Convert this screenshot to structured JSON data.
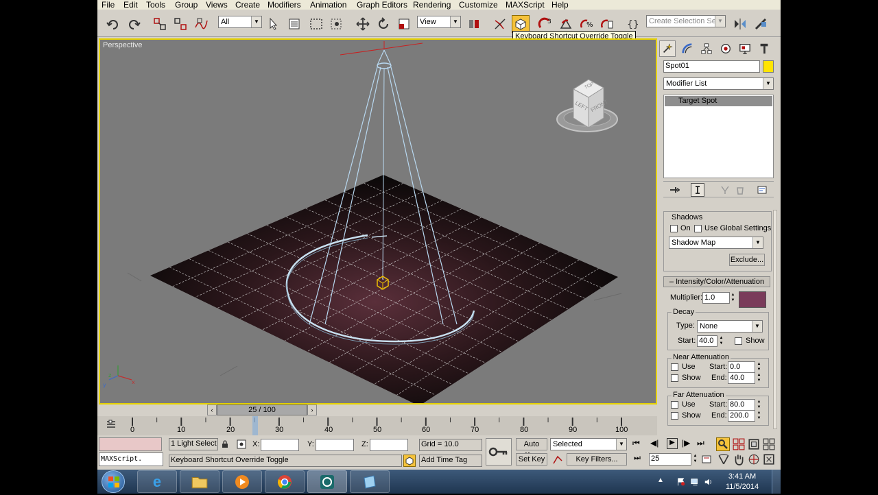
{
  "menubar": {
    "items": [
      "File",
      "Edit",
      "Tools",
      "Group",
      "Views",
      "Create",
      "Modifiers",
      "Animation",
      "Graph Editors",
      "Rendering",
      "Customize",
      "MAXScript",
      "Help"
    ]
  },
  "toolbar": {
    "selection_filter": "All",
    "ref_coord": "View",
    "named_selection_placeholder": "Create Selection Set",
    "tooltip": "Keyboard Shortcut Override Toggle"
  },
  "viewport": {
    "label": "Perspective",
    "viewcube": {
      "top": "TOP",
      "left": "LEFT",
      "front": "FRONT"
    }
  },
  "command_panel": {
    "object_name": "Spot01",
    "object_color": "#ffe400",
    "modifier_list": "Modifier List",
    "stack_item": "Target Spot",
    "shadows": {
      "title": "Shadows",
      "on_label": "On",
      "global_label": "Use Global Settings",
      "shadow_type": "Shadow Map",
      "exclude_label": "Exclude..."
    },
    "intensity": {
      "title": "Intensity/Color/Attenuation",
      "multiplier_label": "Multiplier:",
      "multiplier_value": "1.0",
      "light_color": "#7a3b5a",
      "decay_title": "Decay",
      "type_label": "Type:",
      "type_value": "None",
      "start_label": "Start:",
      "start_value": "40.0",
      "show_label": "Show",
      "near_title": "Near Attenuation",
      "near_use": "Use",
      "near_show": "Show",
      "near_start_label": "Start:",
      "near_start": "0.0",
      "near_end_label": "End:",
      "near_end": "40.0",
      "far_title": "Far Attenuation",
      "far_use": "Use",
      "far_show": "Show",
      "far_start_label": "Start:",
      "far_start": "80.0",
      "far_end_label": "End:",
      "far_end": "200.0"
    }
  },
  "timeline": {
    "slider_label": "25 / 100",
    "ticks": [
      "0",
      "10",
      "20",
      "30",
      "40",
      "50",
      "60",
      "70",
      "80",
      "90",
      "100"
    ]
  },
  "status": {
    "maxscript": "MAXScript.",
    "selection": "1 Light Select",
    "x_label": "X:",
    "y_label": "Y:",
    "z_label": "Z:",
    "grid": "Grid = 10.0",
    "prompt": "Keyboard Shortcut Override Toggle",
    "add_time_tag": "Add Time Tag",
    "auto_key": "Auto Key",
    "set_key": "Set Key",
    "selected": "Selected",
    "key_filters": "Key Filters...",
    "frame": "25"
  },
  "taskbar": {
    "time": "3:41 AM",
    "date": "11/5/2014"
  }
}
